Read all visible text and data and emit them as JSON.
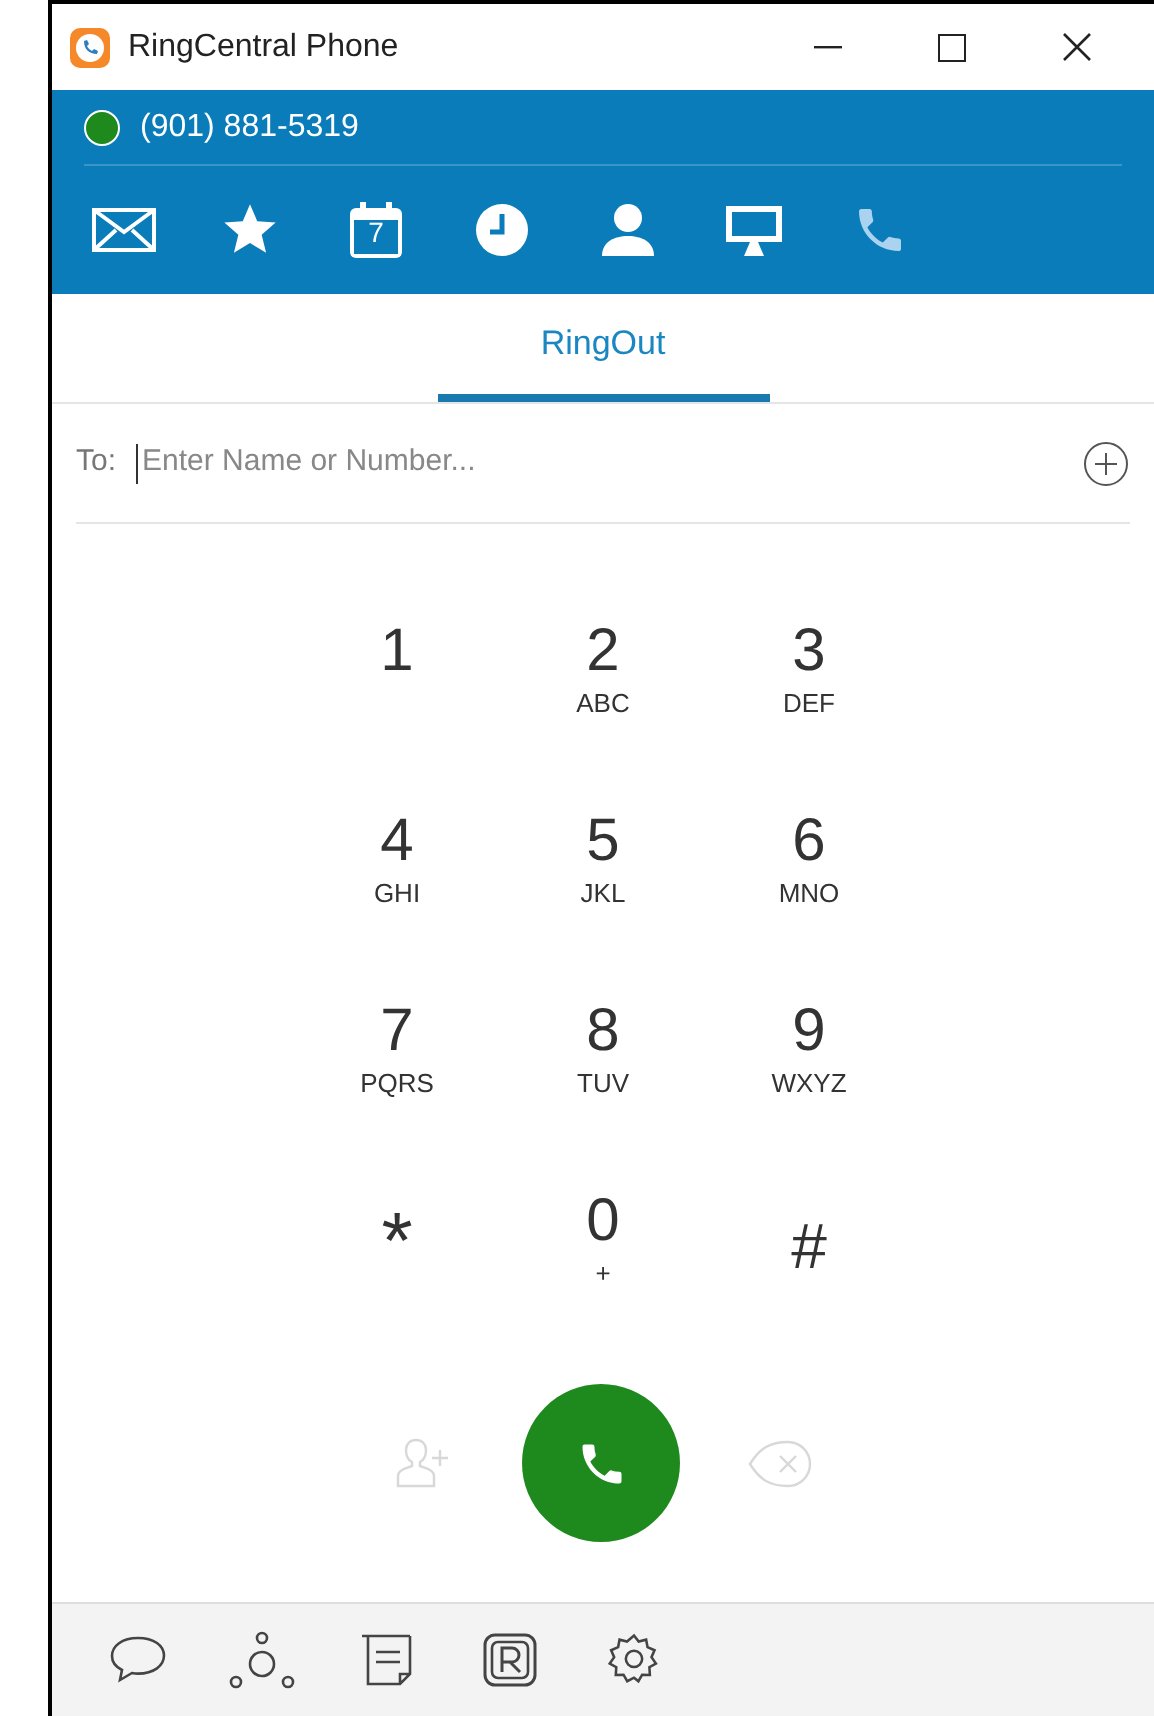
{
  "window": {
    "title": "RingCentral Phone"
  },
  "status": {
    "number": "(901) 881-5319",
    "online": true
  },
  "nav": [
    {
      "kind": "messages",
      "selected": false
    },
    {
      "kind": "favorites",
      "selected": false
    },
    {
      "kind": "calendar",
      "label": "7",
      "selected": false
    },
    {
      "kind": "history",
      "selected": false
    },
    {
      "kind": "contacts",
      "selected": false
    },
    {
      "kind": "meetings",
      "selected": false
    },
    {
      "kind": "phone",
      "selected": true
    }
  ],
  "tabs": [
    {
      "label": "RingOut",
      "selected": true
    }
  ],
  "to_field": {
    "label": "To:",
    "placeholder": "Enter Name or Number..."
  },
  "keypad": [
    {
      "digit": "1"
    },
    {
      "digit": "2",
      "letters": "ABC"
    },
    {
      "digit": "3",
      "letters": "DEF"
    },
    {
      "digit": "4",
      "letters": "GHI"
    },
    {
      "digit": "5",
      "letters": "JKL"
    },
    {
      "digit": "6",
      "letters": "MNO"
    },
    {
      "digit": "7",
      "letters": "PQRS"
    },
    {
      "digit": "8",
      "letters": "TUV"
    },
    {
      "digit": "9",
      "letters": "WXYZ"
    },
    {
      "digit": "*"
    },
    {
      "digit": "0",
      "letters": "+"
    },
    {
      "digit": "#"
    }
  ],
  "actions": {
    "add_contact_disabled": true,
    "backspace_disabled": true
  },
  "bottom_bar": [
    {
      "kind": "chat"
    },
    {
      "kind": "glip"
    },
    {
      "kind": "notes"
    },
    {
      "kind": "app"
    },
    {
      "kind": "settings"
    }
  ]
}
